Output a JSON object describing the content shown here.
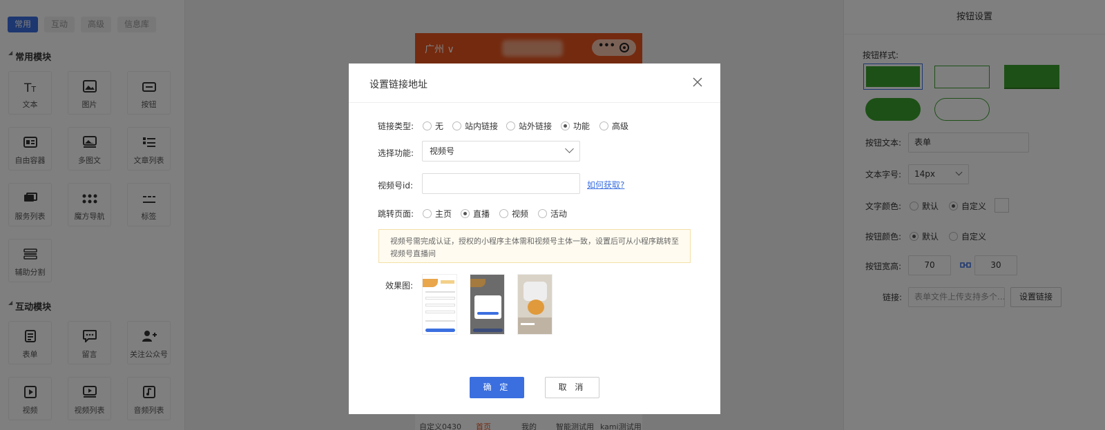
{
  "left": {
    "tabs": [
      "常用",
      "互动",
      "高级",
      "信息库"
    ],
    "common_title": "常用模块",
    "common_modules": [
      {
        "label": "文本",
        "icon": "text-icon"
      },
      {
        "label": "图片",
        "icon": "image-icon"
      },
      {
        "label": "按钮",
        "icon": "button-icon"
      },
      {
        "label": "自由容器",
        "icon": "container-icon"
      },
      {
        "label": "多图文",
        "icon": "multi-image-text-icon"
      },
      {
        "label": "文章列表",
        "icon": "article-list-icon"
      },
      {
        "label": "服务列表",
        "icon": "service-list-icon"
      },
      {
        "label": "魔方导航",
        "icon": "grid-nav-icon"
      },
      {
        "label": "标签",
        "icon": "tag-icon"
      },
      {
        "label": "辅助分割",
        "icon": "divider-icon"
      }
    ],
    "interactive_title": "互动模块",
    "interactive_modules": [
      {
        "label": "表单",
        "icon": "form-icon"
      },
      {
        "label": "留言",
        "icon": "comment-icon"
      },
      {
        "label": "关注公众号",
        "icon": "follow-account-icon"
      },
      {
        "label": "视频",
        "icon": "video-icon"
      },
      {
        "label": "视频列表",
        "icon": "video-list-icon"
      },
      {
        "label": "音频列表",
        "icon": "audio-list-icon"
      }
    ]
  },
  "canvas": {
    "city": "广州 ∨",
    "tabbar": [
      "自定义0430",
      "首页",
      "我的",
      "智能测试用",
      "kami测试用"
    ]
  },
  "right": {
    "title": "按钮设置",
    "style_label": "按钮样式:",
    "text_label": "按钮文本:",
    "text_value": "表单",
    "font_size_label": "文本字号:",
    "font_size_value": "14px",
    "text_color_label": "文字颜色:",
    "text_color_options": [
      "默认",
      "自定义"
    ],
    "btn_color_label": "按钮颜色:",
    "btn_color_options": [
      "默认",
      "自定义"
    ],
    "size_label": "按钮宽高:",
    "width_value": "70",
    "height_value": "30",
    "link_label": "链接:",
    "link_placeholder": "表单文件上传支持多个...",
    "set_link_button": "设置链接",
    "colors": {
      "button_green": "#3aa02c"
    }
  },
  "dialog": {
    "title": "设置链接地址",
    "link_type_label": "链接类型:",
    "link_types": [
      "无",
      "站内链接",
      "站外链接",
      "功能",
      "高级"
    ],
    "link_type_selected": "功能",
    "function_label": "选择功能:",
    "function_value": "视频号",
    "id_label": "视频号id:",
    "id_value": "",
    "how_to_get": "如何获取?",
    "jump_label": "跳转页面:",
    "jump_options": [
      "主页",
      "直播",
      "视频",
      "活动"
    ],
    "jump_selected": "直播",
    "notice": "视频号需完成认证，授权的小程序主体需和视频号主体一致，设置后可从小程序跳转至视频号直播间",
    "preview_label": "效果图:",
    "ok_button": "确 定",
    "cancel_button": "取 消"
  }
}
